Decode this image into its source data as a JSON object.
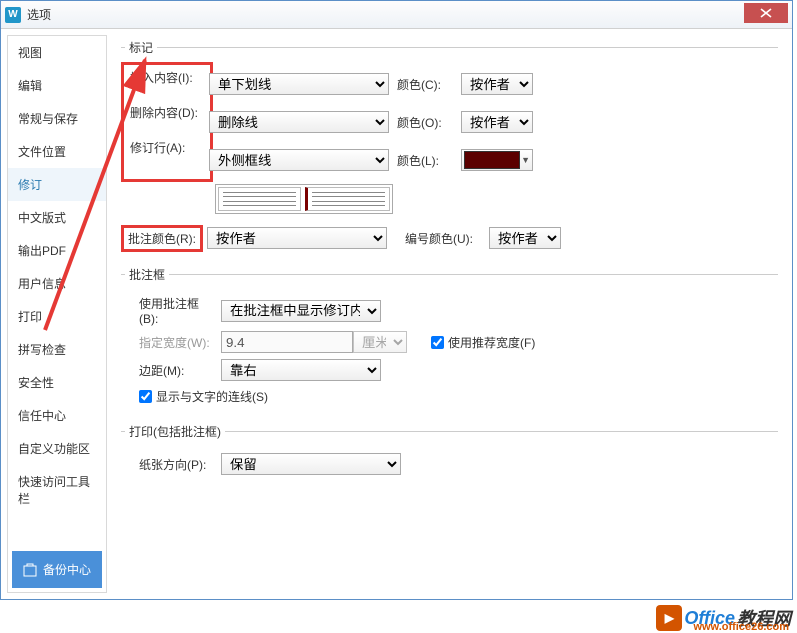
{
  "window": {
    "title": "选项"
  },
  "sidebar": {
    "items": [
      "视图",
      "编辑",
      "常规与保存",
      "文件位置",
      "修订",
      "中文版式",
      "输出PDF",
      "用户信息",
      "打印",
      "拼写检查",
      "安全性",
      "信任中心",
      "自定义功能区",
      "快速访问工具栏"
    ],
    "active_index": 4,
    "backup_label": "备份中心"
  },
  "sections": {
    "marks": {
      "legend": "标记",
      "insert": {
        "label": "插入内容(I):",
        "value": "单下划线",
        "color_label": "颜色(C):",
        "color_value": "按作者"
      },
      "delete": {
        "label": "删除内容(D):",
        "value": "删除线",
        "color_label": "颜色(O):",
        "color_value": "按作者"
      },
      "revline": {
        "label": "修订行(A):",
        "value": "外侧框线",
        "color_label": "颜色(L):"
      },
      "comment_color": {
        "label": "批注颜色(R):",
        "value": "按作者",
        "num_color_label": "编号颜色(U):",
        "num_color_value": "按作者"
      }
    },
    "comment_box": {
      "legend": "批注框",
      "use_box": {
        "label": "使用批注框(B):",
        "value": "在批注框中显示修订内容"
      },
      "width": {
        "label": "指定宽度(W):",
        "value": "9.4",
        "unit": "厘米"
      },
      "recommend": {
        "label": "使用推荐宽度(F)",
        "checked": true
      },
      "margin": {
        "label": "边距(M):",
        "value": "靠右"
      },
      "show_lines": {
        "label": "显示与文字的连线(S)",
        "checked": true
      }
    },
    "print": {
      "legend": "打印(包括批注框)",
      "orientation": {
        "label": "纸张方向(P):",
        "value": "保留"
      }
    }
  },
  "watermark": {
    "brand": "Office",
    "suffix": "教程网",
    "url": "www.office26.com"
  }
}
